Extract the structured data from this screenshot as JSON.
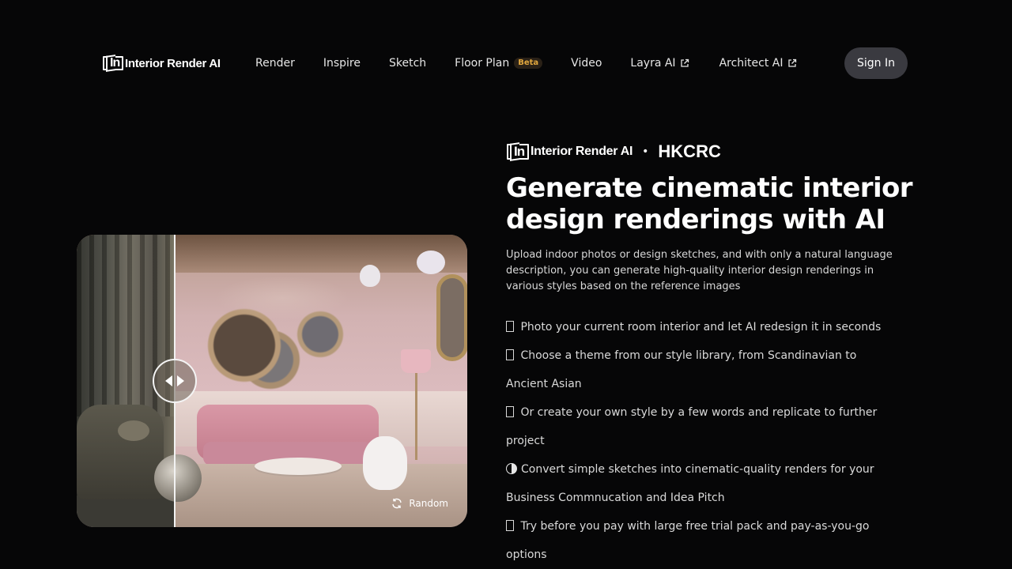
{
  "brand": {
    "name": "Interior Render AI",
    "mark": "In"
  },
  "nav": {
    "items": [
      {
        "label": "Render"
      },
      {
        "label": "Inspire"
      },
      {
        "label": "Sketch"
      },
      {
        "label": "Floor Plan",
        "badge": "Beta"
      },
      {
        "label": "Video"
      },
      {
        "label": "Layra AI",
        "external": true
      },
      {
        "label": "Architect AI",
        "external": true
      }
    ],
    "sign_in": "Sign In"
  },
  "compare": {
    "random_label": "Random",
    "icons": {
      "handle": "compare-slider-handle-icon",
      "random": "refresh-icon"
    }
  },
  "hero": {
    "partner_dot": "•",
    "partner": "HKCRC",
    "headline": "Generate cinematic interior design renderings with AI",
    "description": "Upload indoor photos or design sketches, and with only a natural language description, you can generate high-quality interior design renderings in various styles based on the reference images",
    "features": [
      {
        "icon": "unsupported-glyph-icon",
        "text": "Photo your current room interior and let AI redesign it in seconds"
      },
      {
        "icon": "unsupported-glyph-icon",
        "text": "Choose a theme from our style library, from Scandinavian to Ancient Asian"
      },
      {
        "icon": "unsupported-glyph-icon",
        "text": "Or create your own style by a few words and replicate to further project"
      },
      {
        "icon": "half-circle-icon",
        "text": "Convert simple sketches into cinematic-quality renders for your Business Commnucation and Idea Pitch"
      },
      {
        "icon": "unsupported-glyph-icon",
        "text": "Try before you pay with large free trial pack and pay-as-you-go options"
      }
    ]
  },
  "colors": {
    "background": "#060607",
    "button": "#3a3a40",
    "beta": "#e1a73e"
  }
}
